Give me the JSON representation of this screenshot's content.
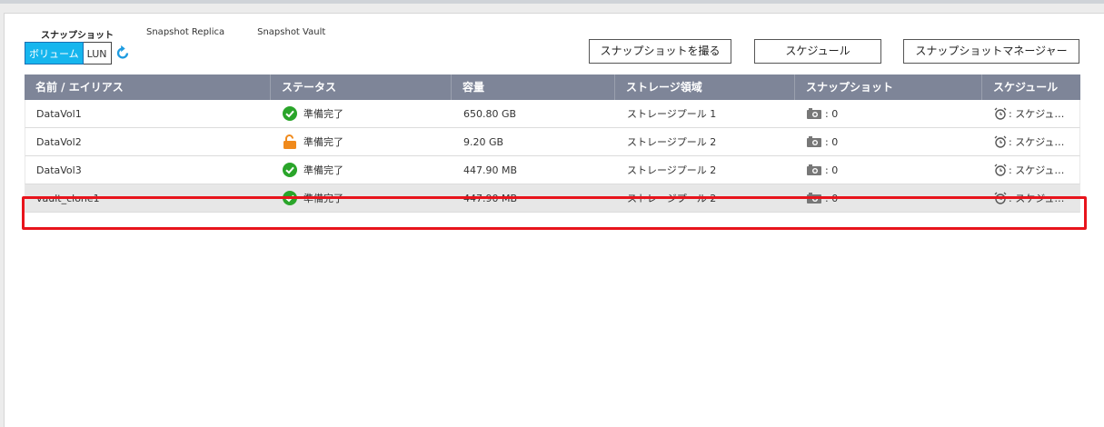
{
  "tabs": [
    {
      "label": "スナップショット",
      "active": true
    },
    {
      "label": "Snapshot Replica",
      "active": false
    },
    {
      "label": "Snapshot Vault",
      "active": false
    }
  ],
  "toggle": {
    "volume_label": "ボリューム",
    "lun_label": "LUN",
    "selected": "ボリューム"
  },
  "buttons": {
    "take_snapshot": "スナップショットを撮る",
    "schedule": "スケジュール",
    "snapshot_manager": "スナップショットマネージャー"
  },
  "table": {
    "headers": [
      "名前 / エイリアス",
      "ステータス",
      "容量",
      "ストレージ領域",
      "スナップショット",
      "スケジュール"
    ],
    "rows": [
      {
        "name": "DataVol1",
        "status": "準備完了",
        "status_icon": "check-circle-icon",
        "capacity": "650.80 GB",
        "storage": "ストレージプール 1",
        "snapshots": ": 0",
        "schedule": ": スケジュ…",
        "selected": false
      },
      {
        "name": "DataVol2",
        "status": "準備完了",
        "status_icon": "unlocked-padlock-icon",
        "capacity": "9.20 GB",
        "storage": "ストレージプール 2",
        "snapshots": ": 0",
        "schedule": ": スケジュ…",
        "selected": false
      },
      {
        "name": "DataVol3",
        "status": "準備完了",
        "status_icon": "check-circle-icon",
        "capacity": "447.90 MB",
        "storage": "ストレージプール 2",
        "snapshots": ": 0",
        "schedule": ": スケジュ…",
        "selected": false
      },
      {
        "name": "vault_clone1",
        "status": "準備完了",
        "status_icon": "check-circle-icon",
        "capacity": "447.90 MB",
        "storage": "ストレージプール 2",
        "snapshots": ": 0",
        "schedule": ": スケジュ…",
        "selected": true
      }
    ]
  },
  "colors": {
    "accent": "#16b6ee",
    "header_bg": "#7e8598",
    "ok_green": "#2aa52a",
    "lock_orange": "#f08a1c",
    "highlight_red": "#e8141c"
  }
}
